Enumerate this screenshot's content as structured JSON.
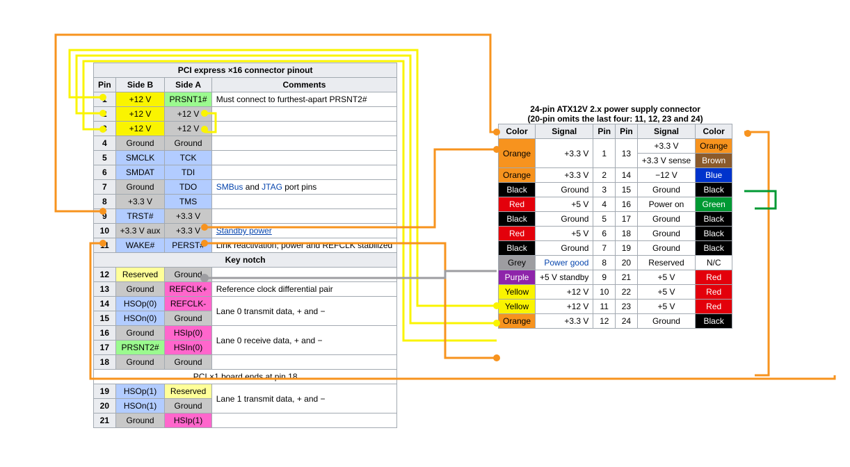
{
  "colors": {
    "orange": "#f7931e",
    "yellow": "#faf400",
    "red": "#e3000b",
    "black": "#000000",
    "purple": "#8e24aa",
    "green": "#009933",
    "blue": "#0033cc",
    "brown": "#8b5a2b",
    "grey": "#9d9da1",
    "magenta": "#ff66cc",
    "ltgrey": "#c8c8c8",
    "hdr": "#eaecf0",
    "ltyellow": "#ffff99",
    "ltgreen": "#9bfa8f",
    "ltblue": "#b2ccff"
  },
  "pci": {
    "title": "PCI express ×16 connector pinout",
    "hdr": [
      "Pin",
      "Side B",
      "Side A",
      "Comments"
    ],
    "keynotch": "Key notch",
    "end18": "PCI ×1 board ends at pin 18",
    "rows": [
      {
        "pin": 1,
        "b": {
          "t": "+12 V",
          "c": "yellow"
        },
        "a": {
          "t": "PRSNT1#",
          "c": "ltgreen"
        },
        "cm": "Must connect to furthest-apart PRSNT2#"
      },
      {
        "pin": 2,
        "b": {
          "t": "+12 V",
          "c": "yellow"
        },
        "a": {
          "t": "+12 V",
          "c": "ltgrey"
        }
      },
      {
        "pin": 3,
        "b": {
          "t": "+12 V",
          "c": "yellow"
        },
        "a": {
          "t": "+12 V",
          "c": "ltgrey"
        }
      },
      {
        "pin": 4,
        "b": {
          "t": "Ground",
          "c": "ltgrey"
        },
        "a": {
          "t": "Ground",
          "c": "ltgrey"
        }
      },
      {
        "pin": 5,
        "b": {
          "t": "SMCLK",
          "c": "ltblue"
        },
        "a": {
          "t": "TCK",
          "c": "ltblue"
        }
      },
      {
        "pin": 6,
        "b": {
          "t": "SMDAT",
          "c": "ltblue"
        },
        "a": {
          "t": "TDI",
          "c": "ltblue"
        }
      },
      {
        "pin": 7,
        "b": {
          "t": "Ground",
          "c": "ltgrey"
        },
        "a": {
          "t": "TDO",
          "c": "ltblue"
        },
        "cm": "SMBus and JTAG port pins",
        "links": [
          "SMBus",
          "JTAG"
        ]
      },
      {
        "pin": 8,
        "b": {
          "t": "+3.3 V",
          "c": "ltgrey"
        },
        "a": {
          "t": "TMS",
          "c": "ltblue"
        }
      },
      {
        "pin": 9,
        "b": {
          "t": "TRST#",
          "c": "ltblue"
        },
        "a": {
          "t": "+3.3 V",
          "c": "ltgrey"
        }
      },
      {
        "pin": 10,
        "b": {
          "t": "+3.3 V aux",
          "c": "ltgrey"
        },
        "a": {
          "t": "+3.3 V",
          "c": "ltgrey"
        },
        "cm": "Standby power",
        "link_all": true
      },
      {
        "pin": 11,
        "b": {
          "t": "WAKE#",
          "c": "ltblue"
        },
        "a": {
          "t": "PERST#",
          "c": "ltblue"
        },
        "cm": "Link reactivation; power and REFCLK stabilized"
      },
      {
        "pin": 12,
        "b": {
          "t": "Reserved",
          "c": "ltyellow"
        },
        "a": {
          "t": "Ground",
          "c": "ltgrey"
        }
      },
      {
        "pin": 13,
        "b": {
          "t": "Ground",
          "c": "ltgrey"
        },
        "a": {
          "t": "REFCLK+",
          "c": "magenta"
        },
        "cm": "Reference clock differential pair"
      },
      {
        "pin": 14,
        "b": {
          "t": "HSOp(0)",
          "c": "ltblue"
        },
        "a": {
          "t": "REFCLK-",
          "c": "magenta"
        },
        "cm": "Lane 0 transmit data, + and −",
        "span": 2
      },
      {
        "pin": 15,
        "b": {
          "t": "HSOn(0)",
          "c": "ltblue"
        },
        "a": {
          "t": "Ground",
          "c": "ltgrey"
        }
      },
      {
        "pin": 16,
        "b": {
          "t": "Ground",
          "c": "ltgrey"
        },
        "a": {
          "t": "HSIp(0)",
          "c": "magenta"
        },
        "cm": "Lane 0 receive data, + and −",
        "span": 2
      },
      {
        "pin": 17,
        "b": {
          "t": "PRSNT2#",
          "c": "ltgreen"
        },
        "a": {
          "t": "HSIn(0)",
          "c": "magenta"
        }
      },
      {
        "pin": 18,
        "b": {
          "t": "Ground",
          "c": "ltgrey"
        },
        "a": {
          "t": "Ground",
          "c": "ltgrey"
        }
      },
      {
        "pin": 19,
        "b": {
          "t": "HSOp(1)",
          "c": "ltblue"
        },
        "a": {
          "t": "Reserved",
          "c": "ltyellow"
        },
        "cm": "Lane 1 transmit data, + and −",
        "span": 2
      },
      {
        "pin": 20,
        "b": {
          "t": "HSOn(1)",
          "c": "ltblue"
        },
        "a": {
          "t": "Ground",
          "c": "ltgrey"
        }
      },
      {
        "pin": 21,
        "b": {
          "t": "Ground",
          "c": "ltgrey"
        },
        "a": {
          "t": "HSIp(1)",
          "c": "magenta"
        }
      }
    ]
  },
  "atx": {
    "title": "24-pin ATX12V 2.x power supply connector",
    "subtitle": "(20-pin omits the last four: 11, 12, 23 and 24)",
    "hdr": [
      "Color",
      "Signal",
      "Pin",
      "Pin",
      "Signal",
      "Color"
    ],
    "rows": [
      {
        "l": {
          "c": "orange",
          "t": "Orange"
        },
        "ls": "+3.3 V",
        "lp": 1,
        "rp": 13,
        "rs": [
          "+3.3 V",
          "+3.3 V sense"
        ],
        "r": [
          {
            "c": "orange",
            "t": "Orange"
          },
          {
            "c": "brown",
            "t": "Brown"
          }
        ]
      },
      {
        "l": {
          "c": "orange",
          "t": "Orange"
        },
        "ls": "+3.3 V",
        "lp": 2,
        "rp": 14,
        "rs": "−12 V",
        "r": {
          "c": "blue",
          "t": "Blue"
        }
      },
      {
        "l": {
          "c": "black",
          "t": "Black"
        },
        "ls": "Ground",
        "lp": 3,
        "rp": 15,
        "rs": "Ground",
        "r": {
          "c": "black",
          "t": "Black"
        }
      },
      {
        "l": {
          "c": "red",
          "t": "Red"
        },
        "ls": "+5 V",
        "lp": 4,
        "rp": 16,
        "rs": "Power on",
        "r": {
          "c": "green",
          "t": "Green"
        }
      },
      {
        "l": {
          "c": "black",
          "t": "Black"
        },
        "ls": "Ground",
        "lp": 5,
        "rp": 17,
        "rs": "Ground",
        "r": {
          "c": "black",
          "t": "Black"
        }
      },
      {
        "l": {
          "c": "red",
          "t": "Red"
        },
        "ls": "+5 V",
        "lp": 6,
        "rp": 18,
        "rs": "Ground",
        "r": {
          "c": "black",
          "t": "Black"
        }
      },
      {
        "l": {
          "c": "black",
          "t": "Black"
        },
        "ls": "Ground",
        "lp": 7,
        "rp": 19,
        "rs": "Ground",
        "r": {
          "c": "black",
          "t": "Black"
        }
      },
      {
        "l": {
          "c": "grey",
          "t": "Grey"
        },
        "ls": "Power good",
        "ls_link": true,
        "lp": 8,
        "rp": 20,
        "rs": "Reserved",
        "r": {
          "c": null,
          "t": "N/C"
        }
      },
      {
        "l": {
          "c": "purple",
          "t": "Purple"
        },
        "ls": "+5 V standby",
        "lp": 9,
        "rp": 21,
        "rs": "+5 V",
        "r": {
          "c": "red",
          "t": "Red"
        }
      },
      {
        "l": {
          "c": "yellow",
          "t": "Yellow"
        },
        "ls": "+12 V",
        "lp": 10,
        "rp": 22,
        "rs": "+5 V",
        "r": {
          "c": "red",
          "t": "Red"
        }
      },
      {
        "l": {
          "c": "yellow",
          "t": "Yellow"
        },
        "ls": "+12 V",
        "lp": 11,
        "rp": 23,
        "rs": "+5 V",
        "r": {
          "c": "red",
          "t": "Red"
        }
      },
      {
        "l": {
          "c": "orange",
          "t": "Orange"
        },
        "ls": "+3.3 V",
        "lp": 12,
        "rp": 24,
        "rs": "Ground",
        "r": {
          "c": "black",
          "t": "Black"
        }
      }
    ]
  }
}
